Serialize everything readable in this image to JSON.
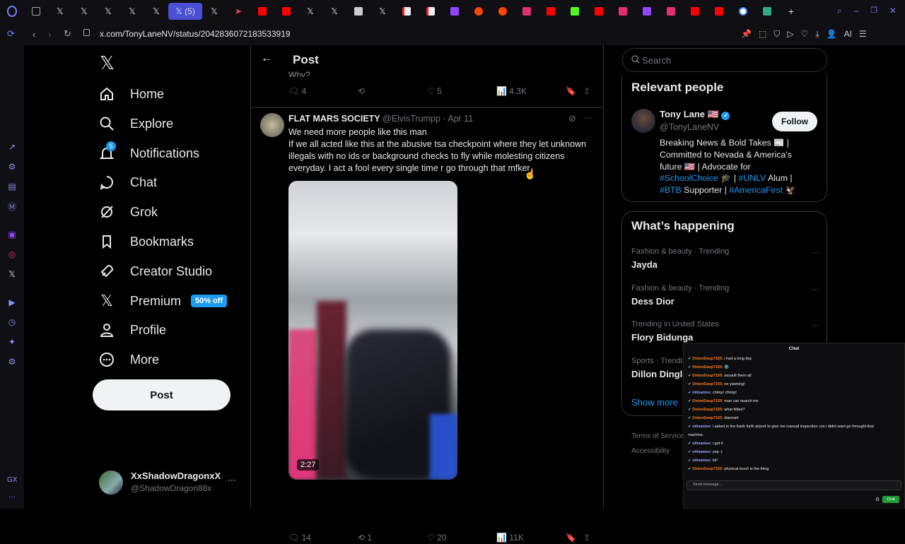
{
  "browser": {
    "tab_count_label": "(5)",
    "url": "x.com/TonyLaneNV/status/2042836072183533919",
    "ai_label": "AI",
    "tabs": [
      "opera",
      "image",
      "x",
      "x",
      "x",
      "x",
      "x",
      "x-active",
      "x",
      "arrow",
      "youtube",
      "youtube",
      "x",
      "x",
      "image2",
      "x",
      "file",
      "file2",
      "twitch",
      "reddit",
      "reddit",
      "instagram",
      "youtube",
      "kick",
      "youtube",
      "instagram",
      "twitch2",
      "instagram",
      "youtube",
      "youtube",
      "google",
      "image3",
      "plus"
    ],
    "gx_label": "GX"
  },
  "nav": {
    "home": "Home",
    "explore": "Explore",
    "notifications": "Notifications",
    "notifications_badge": "5",
    "chat": "Chat",
    "grok": "Grok",
    "bookmarks": "Bookmarks",
    "creator_studio": "Creator Studio",
    "premium": "Premium",
    "premium_badge": "50% off",
    "profile": "Profile",
    "more": "More",
    "post_button": "Post"
  },
  "account": {
    "name": "XxShadowDragonxX",
    "handle": "@ShadowDragon88x"
  },
  "header": {
    "title": "Post"
  },
  "prev_post": {
    "snippet": "Why?",
    "replies": "4",
    "likes": "5",
    "views": "4.3K"
  },
  "post": {
    "author": "FLAT MARS SOCIETY",
    "handle": "@ElvisTrumpp",
    "date": "· Apr 11",
    "line1": "We need more people like this man",
    "line2": "If we all acted like this at the abusive tsa checkpoint where they let unknown illegals with no ids or background checks to fly while molesting citizens everyday. I act a fool every single time r go through that mfker",
    "video_duration": "2:27",
    "replies": "14",
    "reposts": "1",
    "likes": "20",
    "views": "11K"
  },
  "search": {
    "placeholder": "Search"
  },
  "relevant": {
    "title": "Relevant people",
    "name": "Tony Lane 🇺🇸",
    "handle": "@TonyLaneNV",
    "follow": "Follow",
    "bio1": "Breaking News & Bold Takes 📰 |",
    "bio2": "Committed to Nevada & America's",
    "bio3": "future 🇺🇸 | Advocate for",
    "bio4_link1": "#SchoolChoice",
    "bio4_mid": " 🎓 | ",
    "bio4_link2": "#UNLV",
    "bio4_end": " Alum |",
    "bio5_link1": "#BTB",
    "bio5_mid": " Supporter | ",
    "bio5_link2": "#AmericaFirst",
    "bio5_end": " 🦅"
  },
  "happening": {
    "title": "What’s happening",
    "trends": [
      {
        "category": "Fashion & beauty · Trending",
        "name": "Jayda"
      },
      {
        "category": "Fashion & beauty · Trending",
        "name": "Dess Dior"
      },
      {
        "category": "Trending in United States",
        "name": "Flory Bidunga"
      },
      {
        "category": "Sports · Trending",
        "name": "Dillon Dingle"
      }
    ],
    "show_more": "Show more"
  },
  "footer": {
    "terms": "Terms of Service",
    "accessibility": "Accessibility"
  },
  "chat": {
    "title": "Chat",
    "input_placeholder": "Send message...",
    "send": "Chat",
    "messages": [
      {
        "user": "OnionSoup7155:",
        "text": " i had a long day",
        "u": "a"
      },
      {
        "user": "OnionSoup7155:",
        "text": " 🌚",
        "u": "a"
      },
      {
        "user": "OnionSoup7155:",
        "text": " assault them all",
        "u": "a"
      },
      {
        "user": "OnionSoup7155:",
        "text": " no yawning!",
        "u": "a"
      },
      {
        "user": "nilmanise:",
        "text": " chimp! chimp!",
        "u": "b"
      },
      {
        "user": "OnionSoup7155:",
        "text": " man can search me",
        "u": "a"
      },
      {
        "user": "OnionSoup7155:",
        "text": " what titties?",
        "u": "a"
      },
      {
        "user": "OnionSoup7155:",
        "text": " diarreah",
        "u": "a"
      },
      {
        "user": "nilmanise:",
        "text": " i asked in the frank furth airport to give me manual inspection cos i didnt want go throught that",
        "u": "b"
      },
      {
        "user": "",
        "text": "machine.",
        "u": "c"
      },
      {
        "user": "nilmanise:",
        "text": " i got it",
        "u": "b"
      },
      {
        "user": "nilmanise:",
        "text": " yep :)",
        "u": "b"
      },
      {
        "user": "nilmanise:",
        "text": " lol!",
        "u": "b"
      },
      {
        "user": "OnionSoup7155:",
        "text": " physical touch is the thing",
        "u": "a"
      }
    ]
  },
  "colors": {
    "accent": "#1d9bf0",
    "tab_active": "#4a4fd6",
    "chat_user_a": "#ff7f27",
    "chat_user_b": "#9aa6ff"
  }
}
